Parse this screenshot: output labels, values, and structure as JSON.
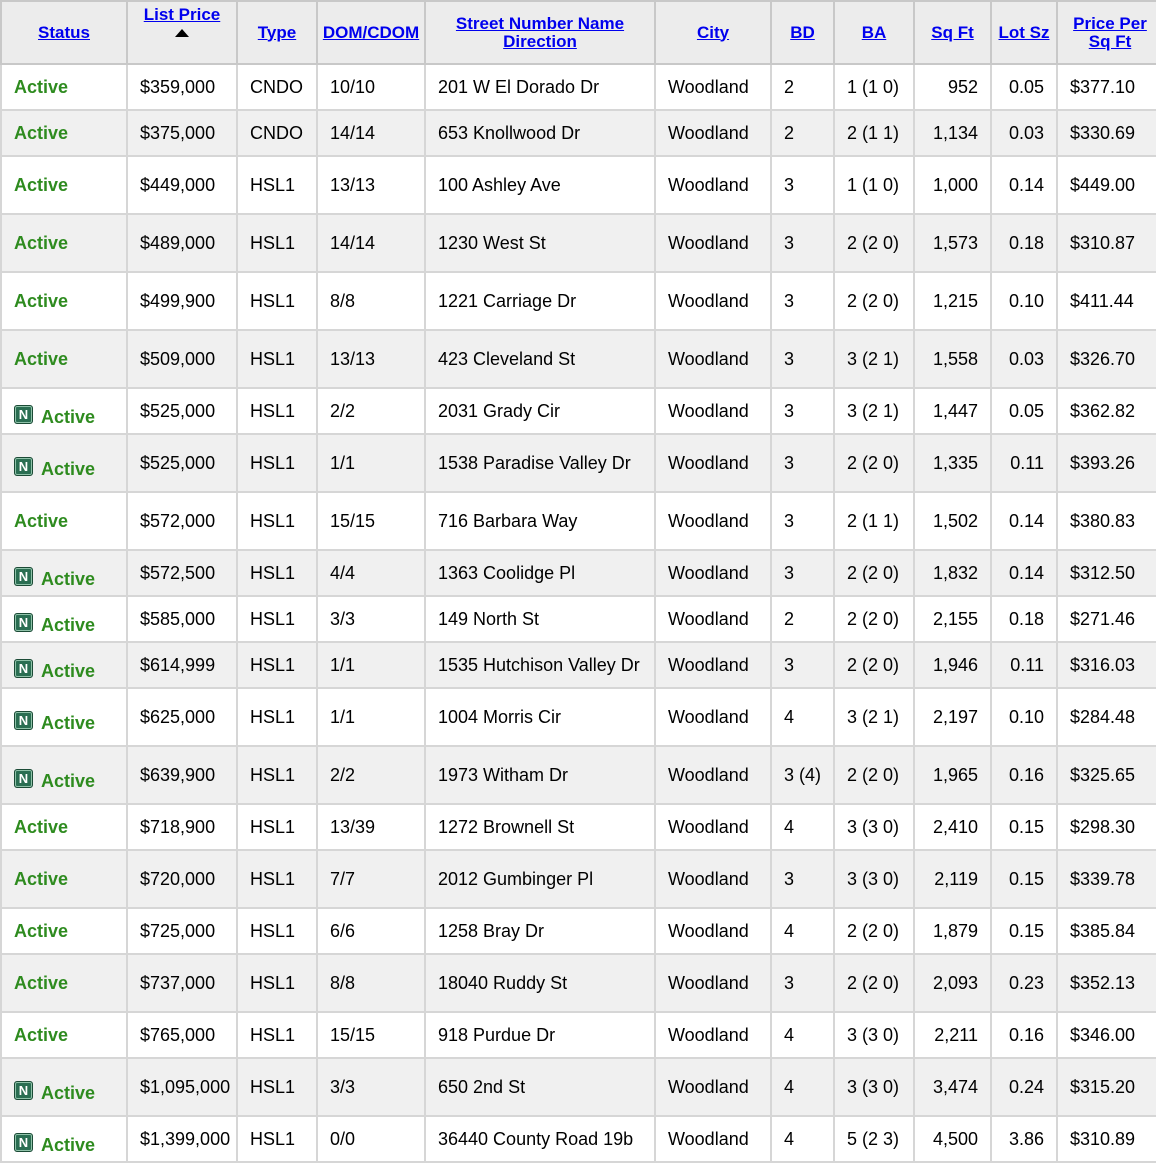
{
  "table": {
    "headers": {
      "status": "Status",
      "list_price": "List Price",
      "type": "Type",
      "dom_cdom": "DOM/CDOM",
      "street": "Street Number Name Direction",
      "city": "City",
      "bd": "BD",
      "ba": "BA",
      "sqft": "Sq Ft",
      "lot": "Lot Sz",
      "ppsf": "Price Per Sq Ft"
    },
    "new_badge_label": "N",
    "rows": [
      {
        "status": "Active",
        "is_new": false,
        "price": "$359,000",
        "type": "CNDO",
        "dom": "10/10",
        "street": "201 W El Dorado Dr",
        "city": "Woodland",
        "bd": "2",
        "ba": "1 (1 0)",
        "sqft": "952",
        "lot": "0.05",
        "ppsf": "$377.10"
      },
      {
        "status": "Active",
        "is_new": false,
        "price": "$375,000",
        "type": "CNDO",
        "dom": "14/14",
        "street": "653 Knollwood Dr",
        "city": "Woodland",
        "bd": "2",
        "ba": "2 (1 1)",
        "sqft": "1,134",
        "lot": "0.03",
        "ppsf": "$330.69"
      },
      {
        "status": "Active",
        "is_new": false,
        "price": "$449,000",
        "type": "HSL1",
        "dom": "13/13",
        "street": "100 Ashley Ave",
        "city": "Woodland",
        "bd": "3",
        "ba": "1 (1 0)",
        "sqft": "1,000",
        "lot": "0.14",
        "ppsf": "$449.00"
      },
      {
        "status": "Active",
        "is_new": false,
        "price": "$489,000",
        "type": "HSL1",
        "dom": "14/14",
        "street": "1230 West St",
        "city": "Woodland",
        "bd": "3",
        "ba": "2 (2 0)",
        "sqft": "1,573",
        "lot": "0.18",
        "ppsf": "$310.87"
      },
      {
        "status": "Active",
        "is_new": false,
        "price": "$499,900",
        "type": "HSL1",
        "dom": "8/8",
        "street": "1221 Carriage Dr",
        "city": "Woodland",
        "bd": "3",
        "ba": "2 (2 0)",
        "sqft": "1,215",
        "lot": "0.10",
        "ppsf": "$411.44"
      },
      {
        "status": "Active",
        "is_new": false,
        "price": "$509,000",
        "type": "HSL1",
        "dom": "13/13",
        "street": "423 Cleveland St",
        "city": "Woodland",
        "bd": "3",
        "ba": "3 (2 1)",
        "sqft": "1,558",
        "lot": "0.03",
        "ppsf": "$326.70"
      },
      {
        "status": "Active",
        "is_new": true,
        "price": "$525,000",
        "type": "HSL1",
        "dom": "2/2",
        "street": "2031 Grady Cir",
        "city": "Woodland",
        "bd": "3",
        "ba": "3 (2 1)",
        "sqft": "1,447",
        "lot": "0.05",
        "ppsf": "$362.82"
      },
      {
        "status": "Active",
        "is_new": true,
        "price": "$525,000",
        "type": "HSL1",
        "dom": "1/1",
        "street": "1538 Paradise Valley Dr",
        "city": "Woodland",
        "bd": "3",
        "ba": "2 (2 0)",
        "sqft": "1,335",
        "lot": "0.11",
        "ppsf": "$393.26"
      },
      {
        "status": "Active",
        "is_new": false,
        "price": "$572,000",
        "type": "HSL1",
        "dom": "15/15",
        "street": "716 Barbara Way",
        "city": "Woodland",
        "bd": "3",
        "ba": "2 (1 1)",
        "sqft": "1,502",
        "lot": "0.14",
        "ppsf": "$380.83"
      },
      {
        "status": "Active",
        "is_new": true,
        "price": "$572,500",
        "type": "HSL1",
        "dom": "4/4",
        "street": "1363 Coolidge Pl",
        "city": "Woodland",
        "bd": "3",
        "ba": "2 (2 0)",
        "sqft": "1,832",
        "lot": "0.14",
        "ppsf": "$312.50"
      },
      {
        "status": "Active",
        "is_new": true,
        "price": "$585,000",
        "type": "HSL1",
        "dom": "3/3",
        "street": "149 North St",
        "city": "Woodland",
        "bd": "2",
        "ba": "2 (2 0)",
        "sqft": "2,155",
        "lot": "0.18",
        "ppsf": "$271.46"
      },
      {
        "status": "Active",
        "is_new": true,
        "price": "$614,999",
        "type": "HSL1",
        "dom": "1/1",
        "street": "1535 Hutchison Valley Dr",
        "city": "Woodland",
        "bd": "3",
        "ba": "2 (2 0)",
        "sqft": "1,946",
        "lot": "0.11",
        "ppsf": "$316.03"
      },
      {
        "status": "Active",
        "is_new": true,
        "price": "$625,000",
        "type": "HSL1",
        "dom": "1/1",
        "street": "1004 Morris Cir",
        "city": "Woodland",
        "bd": "4",
        "ba": "3 (2 1)",
        "sqft": "2,197",
        "lot": "0.10",
        "ppsf": "$284.48"
      },
      {
        "status": "Active",
        "is_new": true,
        "price": "$639,900",
        "type": "HSL1",
        "dom": "2/2",
        "street": "1973 Witham Dr",
        "city": "Woodland",
        "bd": "3 (4)",
        "ba": "2 (2 0)",
        "sqft": "1,965",
        "lot": "0.16",
        "ppsf": "$325.65"
      },
      {
        "status": "Active",
        "is_new": false,
        "price": "$718,900",
        "type": "HSL1",
        "dom": "13/39",
        "street": "1272 Brownell St",
        "city": "Woodland",
        "bd": "4",
        "ba": "3 (3 0)",
        "sqft": "2,410",
        "lot": "0.15",
        "ppsf": "$298.30"
      },
      {
        "status": "Active",
        "is_new": false,
        "price": "$720,000",
        "type": "HSL1",
        "dom": "7/7",
        "street": "2012 Gumbinger Pl",
        "city": "Woodland",
        "bd": "3",
        "ba": "3 (3 0)",
        "sqft": "2,119",
        "lot": "0.15",
        "ppsf": "$339.78"
      },
      {
        "status": "Active",
        "is_new": false,
        "price": "$725,000",
        "type": "HSL1",
        "dom": "6/6",
        "street": "1258 Bray Dr",
        "city": "Woodland",
        "bd": "4",
        "ba": "2 (2 0)",
        "sqft": "1,879",
        "lot": "0.15",
        "ppsf": "$385.84"
      },
      {
        "status": "Active",
        "is_new": false,
        "price": "$737,000",
        "type": "HSL1",
        "dom": "8/8",
        "street": "18040 Ruddy St",
        "city": "Woodland",
        "bd": "3",
        "ba": "2 (2 0)",
        "sqft": "2,093",
        "lot": "0.23",
        "ppsf": "$352.13"
      },
      {
        "status": "Active",
        "is_new": false,
        "price": "$765,000",
        "type": "HSL1",
        "dom": "15/15",
        "street": "918 Purdue Dr",
        "city": "Woodland",
        "bd": "4",
        "ba": "3 (3 0)",
        "sqft": "2,211",
        "lot": "0.16",
        "ppsf": "$346.00"
      },
      {
        "status": "Active",
        "is_new": true,
        "price": "$1,095,000",
        "type": "HSL1",
        "dom": "3/3",
        "street": "650 2nd St",
        "city": "Woodland",
        "bd": "4",
        "ba": "3 (3 0)",
        "sqft": "3,474",
        "lot": "0.24",
        "ppsf": "$315.20"
      },
      {
        "status": "Active",
        "is_new": true,
        "price": "$1,399,000",
        "type": "HSL1",
        "dom": "0/0",
        "street": "36440 County Road 19b",
        "city": "Woodland",
        "bd": "4",
        "ba": "5 (2 3)",
        "sqft": "4,500",
        "lot": "3.86",
        "ppsf": "$310.89"
      }
    ]
  },
  "colors": {
    "status_active": "#2e8b1f",
    "header_link": "#0000ee",
    "new_badge": "#2a6e52"
  }
}
